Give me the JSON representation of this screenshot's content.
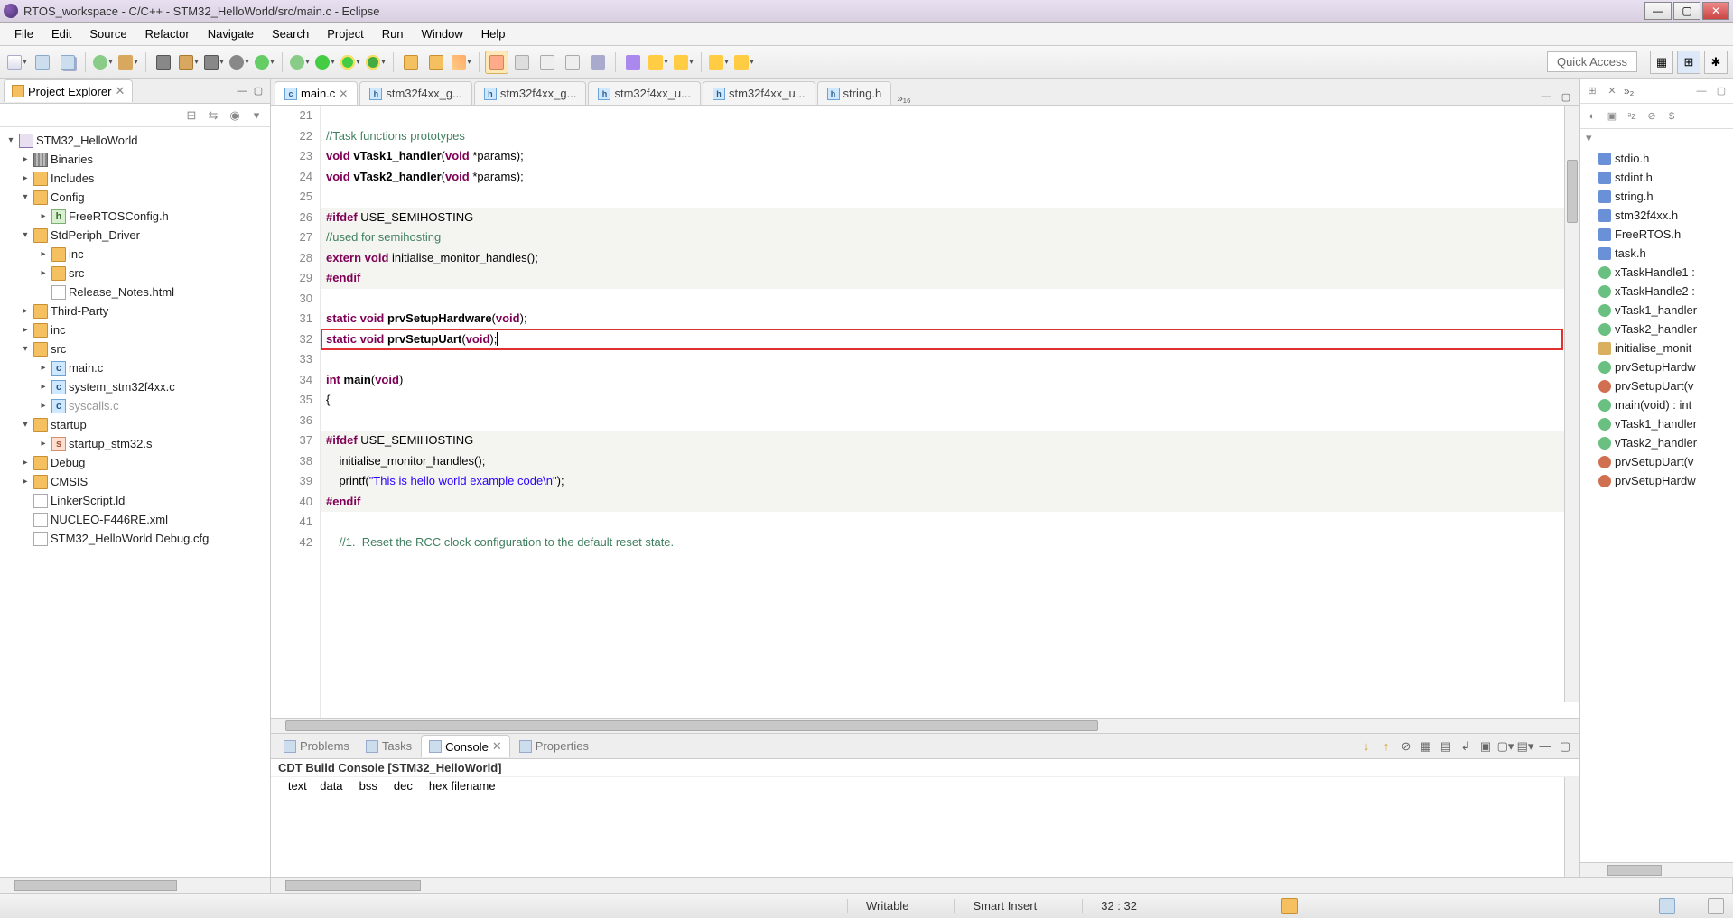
{
  "window": {
    "title": "RTOS_workspace - C/C++ - STM32_HelloWorld/src/main.c - Eclipse"
  },
  "menu": [
    "File",
    "Edit",
    "Source",
    "Refactor",
    "Navigate",
    "Search",
    "Project",
    "Run",
    "Window",
    "Help"
  ],
  "quick_access": "Quick Access",
  "project_explorer": {
    "title": "Project Explorer",
    "tree": [
      {
        "d": 0,
        "exp": "▾",
        "icon": "proj",
        "label": "STM32_HelloWorld"
      },
      {
        "d": 1,
        "exp": "▸",
        "icon": "bin",
        "label": "Binaries"
      },
      {
        "d": 1,
        "exp": "▸",
        "icon": "inc",
        "label": "Includes"
      },
      {
        "d": 1,
        "exp": "▾",
        "icon": "folder",
        "label": "Config"
      },
      {
        "d": 2,
        "exp": "▸",
        "icon": "hfile",
        "label": "FreeRTOSConfig.h"
      },
      {
        "d": 1,
        "exp": "▾",
        "icon": "folder",
        "label": "StdPeriph_Driver"
      },
      {
        "d": 2,
        "exp": "▸",
        "icon": "folder",
        "label": "inc"
      },
      {
        "d": 2,
        "exp": "▸",
        "icon": "folder",
        "label": "src"
      },
      {
        "d": 2,
        "exp": "",
        "icon": "txtfile",
        "label": "Release_Notes.html"
      },
      {
        "d": 1,
        "exp": "▸",
        "icon": "folder",
        "label": "Third-Party"
      },
      {
        "d": 1,
        "exp": "▸",
        "icon": "folder",
        "label": "inc"
      },
      {
        "d": 1,
        "exp": "▾",
        "icon": "folder",
        "label": "src"
      },
      {
        "d": 2,
        "exp": "▸",
        "icon": "cfile",
        "label": "main.c"
      },
      {
        "d": 2,
        "exp": "▸",
        "icon": "cfile",
        "label": "system_stm32f4xx.c"
      },
      {
        "d": 2,
        "exp": "▸",
        "icon": "cfile",
        "label": "syscalls.c",
        "dim": true
      },
      {
        "d": 1,
        "exp": "▾",
        "icon": "folder",
        "label": "startup"
      },
      {
        "d": 2,
        "exp": "▸",
        "icon": "sfile",
        "label": "startup_stm32.s"
      },
      {
        "d": 1,
        "exp": "▸",
        "icon": "folder",
        "label": "Debug"
      },
      {
        "d": 1,
        "exp": "▸",
        "icon": "folder",
        "label": "CMSIS"
      },
      {
        "d": 1,
        "exp": "",
        "icon": "txtfile",
        "label": "LinkerScript.ld"
      },
      {
        "d": 1,
        "exp": "",
        "icon": "txtfile",
        "label": "NUCLEO-F446RE.xml"
      },
      {
        "d": 1,
        "exp": "",
        "icon": "txtfile",
        "label": "STM32_HelloWorld Debug.cfg"
      }
    ]
  },
  "editor_tabs": {
    "items": [
      {
        "label": "main.c",
        "active": true,
        "type": "c"
      },
      {
        "label": "stm32f4xx_g...",
        "type": "h"
      },
      {
        "label": "stm32f4xx_g...",
        "type": "h"
      },
      {
        "label": "stm32f4xx_u...",
        "type": "h"
      },
      {
        "label": "stm32f4xx_u...",
        "type": "h"
      },
      {
        "label": "string.h",
        "type": "h"
      }
    ],
    "overflow": "»₁₆"
  },
  "code": {
    "start": 21,
    "lines": [
      {
        "n": 21,
        "dim": false,
        "html": ""
      },
      {
        "n": 22,
        "dim": false,
        "html": "<span class='tok-comment'>//Task functions prototypes</span>"
      },
      {
        "n": 23,
        "dim": false,
        "html": "<span class='tok-kw'>void</span> <span class='tok-func'>vTask1_handler</span>(<span class='tok-kw'>void</span> *params);"
      },
      {
        "n": 24,
        "dim": false,
        "html": "<span class='tok-kw'>void</span> <span class='tok-func'>vTask2_handler</span>(<span class='tok-kw'>void</span> *params);"
      },
      {
        "n": 25,
        "dim": false,
        "html": ""
      },
      {
        "n": 26,
        "dim": true,
        "html": "<span class='tok-preproc'>#ifdef</span> USE_SEMIHOSTING"
      },
      {
        "n": 27,
        "dim": true,
        "html": "<span class='tok-comment'>//used for semihosting</span>"
      },
      {
        "n": 28,
        "dim": true,
        "html": "<span class='tok-kw'>extern</span> <span class='tok-kw'>void</span> initialise_monitor_handles();"
      },
      {
        "n": 29,
        "dim": true,
        "html": "<span class='tok-preproc'>#endif</span>"
      },
      {
        "n": 30,
        "dim": false,
        "html": ""
      },
      {
        "n": 31,
        "dim": false,
        "html": "<span class='tok-kw'>static</span> <span class='tok-kw'>void</span> <span class='tok-func'>prvSetupHardware</span>(<span class='tok-kw'>void</span>);"
      },
      {
        "n": 32,
        "dim": false,
        "html": "<span class='tok-kw'>static</span> <span class='tok-kw'>void</span> <span class='tok-func'>prvSetupUart</span>(<span class='tok-kw'>void</span>);<span style='border-left:2px solid #000;'></span>"
      },
      {
        "n": 33,
        "dim": false,
        "html": ""
      },
      {
        "n": 34,
        "dim": false,
        "html": "<span class='tok-kw'>int</span> <span class='tok-func'>main</span>(<span class='tok-kw'>void</span>)"
      },
      {
        "n": 35,
        "dim": false,
        "html": "{"
      },
      {
        "n": 36,
        "dim": false,
        "html": ""
      },
      {
        "n": 37,
        "dim": true,
        "html": "<span class='tok-preproc'>#ifdef</span> USE_SEMIHOSTING"
      },
      {
        "n": 38,
        "dim": true,
        "html": "    initialise_monitor_handles();"
      },
      {
        "n": 39,
        "dim": true,
        "html": "    printf(<span class='tok-str'>\"This is hello world example code\\n\"</span>);"
      },
      {
        "n": 40,
        "dim": true,
        "html": "<span class='tok-preproc'>#endif</span>"
      },
      {
        "n": 41,
        "dim": false,
        "html": ""
      },
      {
        "n": 42,
        "dim": false,
        "html": "    <span class='tok-comment'>//1.  Reset the RCC clock configuration to the default reset state.</span>"
      }
    ],
    "highlight_line": 32
  },
  "outline": {
    "overflow": "»₂",
    "items": [
      {
        "icon": "incfile",
        "label": "stdio.h"
      },
      {
        "icon": "incfile",
        "label": "stdint.h"
      },
      {
        "icon": "incfile",
        "label": "string.h"
      },
      {
        "icon": "incfile",
        "label": "stm32f4xx.h"
      },
      {
        "icon": "incfile",
        "label": "FreeRTOS.h"
      },
      {
        "icon": "incfile",
        "label": "task.h"
      },
      {
        "icon": "var",
        "label": "xTaskHandle1 :"
      },
      {
        "icon": "var",
        "label": "xTaskHandle2 :"
      },
      {
        "icon": "func",
        "label": "vTask1_handler"
      },
      {
        "icon": "func",
        "label": "vTask2_handler"
      },
      {
        "icon": "struct",
        "label": "initialise_monit"
      },
      {
        "icon": "func",
        "label": "prvSetupHardw"
      },
      {
        "icon": "priv",
        "label": "prvSetupUart(v"
      },
      {
        "icon": "func",
        "label": "main(void) : int"
      },
      {
        "icon": "func",
        "label": "vTask1_handler"
      },
      {
        "icon": "func",
        "label": "vTask2_handler"
      },
      {
        "icon": "priv",
        "label": "prvSetupUart(v"
      },
      {
        "icon": "priv",
        "label": "prvSetupHardw"
      }
    ]
  },
  "bottom": {
    "tabs": [
      "Problems",
      "Tasks",
      "Console",
      "Properties"
    ],
    "active": 2,
    "title": "CDT Build Console [STM32_HelloWorld]",
    "lines": [
      "   text    data     bss     dec     hex filename"
    ]
  },
  "status": {
    "writable": "Writable",
    "insert": "Smart Insert",
    "pos": "32 : 32"
  }
}
